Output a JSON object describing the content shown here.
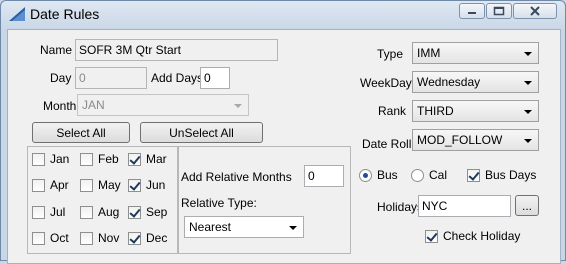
{
  "window": {
    "title": "Date Rules"
  },
  "form": {
    "name_label": "Name",
    "name_value": "SOFR 3M Qtr Start",
    "day_label": "Day",
    "day_value": "0",
    "add_days_label": "Add Days",
    "add_days_value": "0",
    "month_label": "Month",
    "month_value": "JAN",
    "select_all_label": "Select All",
    "unselect_all_label": "UnSelect All"
  },
  "months": [
    {
      "label": "Jan",
      "checked": false
    },
    {
      "label": "Feb",
      "checked": false
    },
    {
      "label": "Mar",
      "checked": true
    },
    {
      "label": "Apr",
      "checked": false
    },
    {
      "label": "May",
      "checked": false
    },
    {
      "label": "Jun",
      "checked": true
    },
    {
      "label": "Jul",
      "checked": false
    },
    {
      "label": "Aug",
      "checked": false
    },
    {
      "label": "Sep",
      "checked": true
    },
    {
      "label": "Oct",
      "checked": false
    },
    {
      "label": "Nov",
      "checked": false
    },
    {
      "label": "Dec",
      "checked": true
    }
  ],
  "relative": {
    "add_months_label": "Add Relative Months",
    "add_months_value": "0",
    "type_label": "Relative Type:",
    "type_value": "Nearest"
  },
  "right": {
    "type_label": "Type",
    "type_value": "IMM",
    "weekday_label": "WeekDay",
    "weekday_value": "Wednesday",
    "rank_label": "Rank",
    "rank_value": "THIRD",
    "date_roll_label": "Date Roll",
    "date_roll_value": "MOD_FOLLOW",
    "radio_bus_label": "Bus",
    "radio_cal_label": "Cal",
    "selected_radio": "Bus",
    "bus_days_label": "Bus Days",
    "bus_days_checked": true,
    "holidays_label": "Holidays",
    "holidays_value": "NYC",
    "browse_label": "...",
    "check_holiday_label": "Check Holiday",
    "check_holiday_checked": true
  }
}
